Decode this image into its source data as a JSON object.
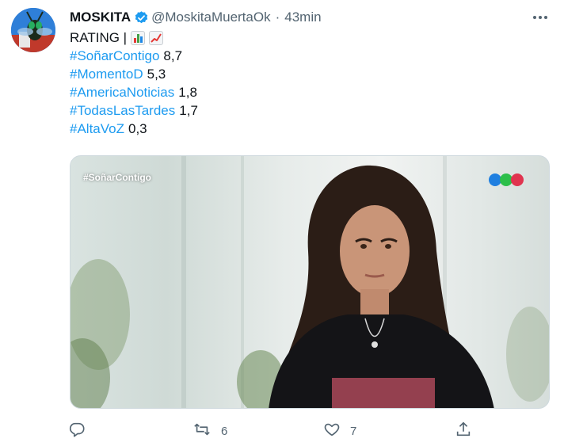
{
  "author": {
    "name": "MOSKITA",
    "handle": "@MoskitaMuertaOk",
    "separator": "·",
    "time": "43min"
  },
  "tweet": {
    "intro": "RATING |",
    "lines": [
      {
        "hashtag": "#SoñarContigo",
        "value": "8,7"
      },
      {
        "hashtag": "#MomentoD",
        "value": "5,3"
      },
      {
        "hashtag": "#AmericaNoticias",
        "value": "1,8"
      },
      {
        "hashtag": "#TodasLasTardes",
        "value": "1,7"
      },
      {
        "hashtag": "#AltaVoZ",
        "value": "0,3"
      }
    ]
  },
  "media": {
    "overlay_tag": "#SoñarContigo",
    "logo_colors": [
      "#1f7fe0",
      "#2cbf4a",
      "#e0344f"
    ]
  },
  "actions": {
    "retweets": "6",
    "likes": "7"
  },
  "colors": {
    "accent": "#1d9bf0",
    "muted": "#536471",
    "text": "#0f1419"
  },
  "icons": [
    "verified-badge-icon",
    "more-icon",
    "bar-chart-emoji",
    "chart-increasing-emoji",
    "reply-icon",
    "retweet-icon",
    "like-icon",
    "share-icon"
  ]
}
